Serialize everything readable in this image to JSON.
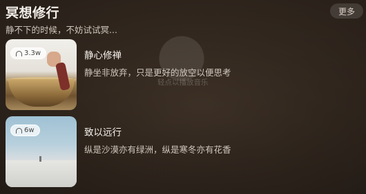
{
  "header": {
    "title": "冥想修行",
    "subtitle": "静不下的时候，不妨试试冥...",
    "more_label": "更多"
  },
  "hint": "轻点以播放音乐",
  "items": [
    {
      "title": "静心修禅",
      "desc": "静坐非放弃，只是更好的放空以便思考",
      "count": "3.3w",
      "icon": "headphone-icon"
    },
    {
      "title": "致以远行",
      "desc": "纵是沙漠亦有绿洲，纵是寒冬亦有花香",
      "count": "6w",
      "icon": "headphone-icon"
    }
  ]
}
